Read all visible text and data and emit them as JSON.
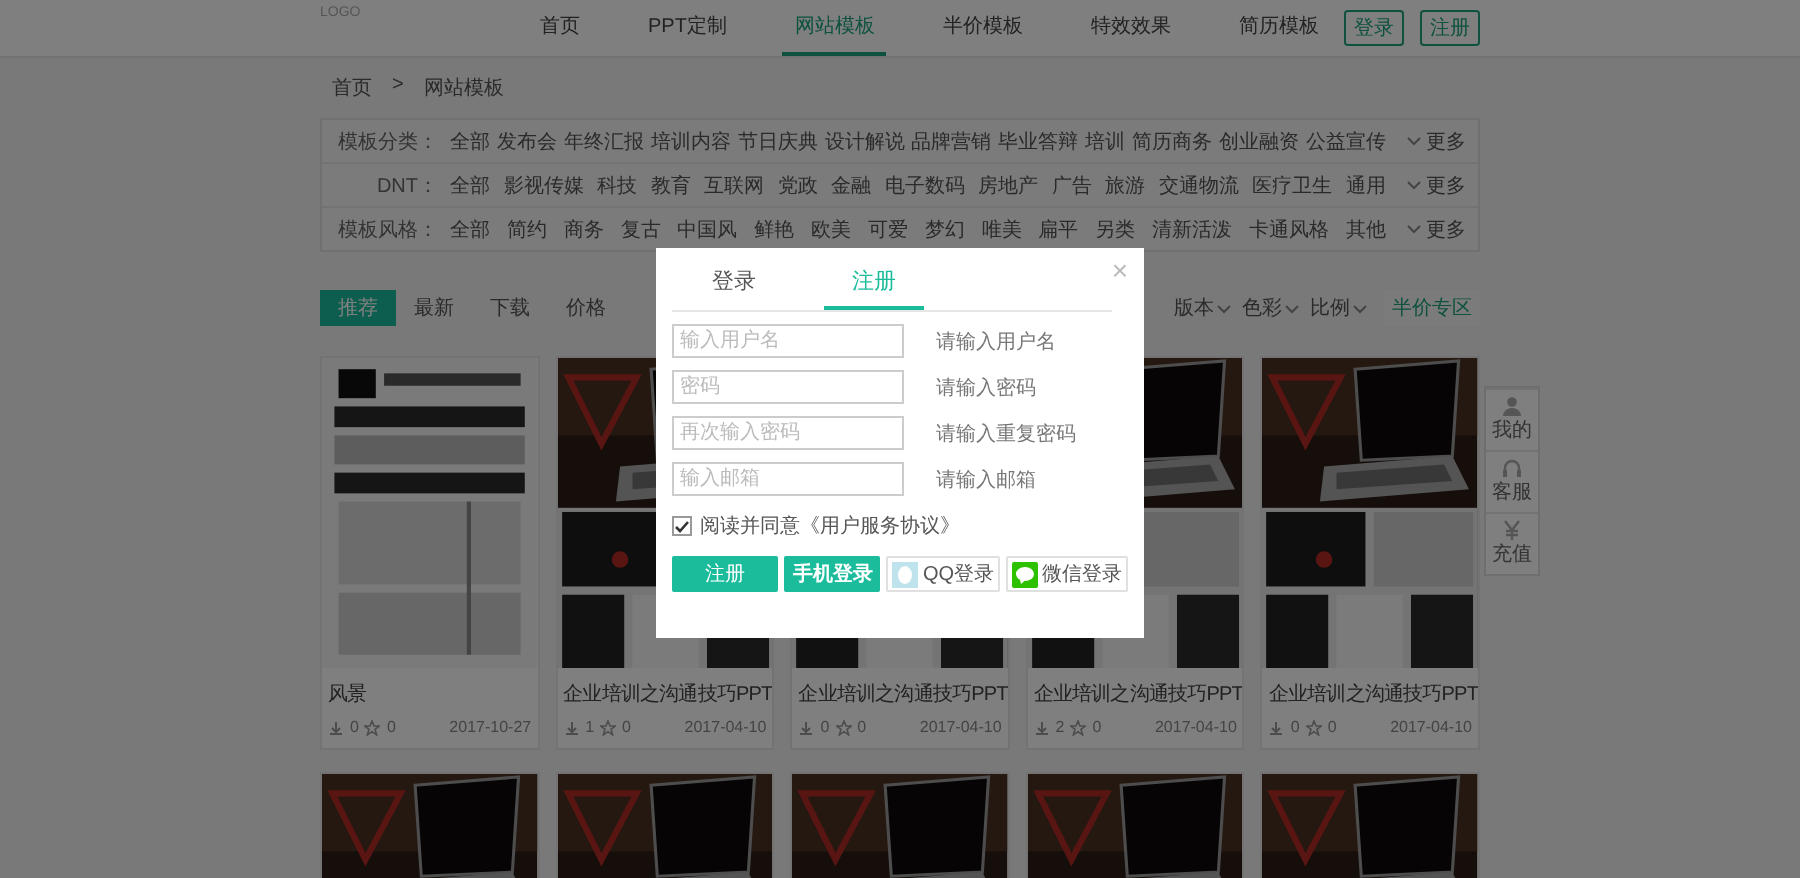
{
  "header": {
    "logo": "LOGO",
    "nav": [
      {
        "label": "首页",
        "selected": false
      },
      {
        "label": "PPT定制",
        "selected": false
      },
      {
        "label": "网站模板",
        "selected": true
      },
      {
        "label": "半价模板",
        "selected": false
      },
      {
        "label": "特效效果",
        "selected": false
      },
      {
        "label": "简历模板",
        "selected": false
      }
    ],
    "buttons": [
      "登录",
      "注册"
    ]
  },
  "breadcrumb": {
    "items": [
      "首页",
      "网站模板"
    ],
    "separator": ">"
  },
  "filters": [
    {
      "label": "模板分类：",
      "options": [
        "全部",
        "发布会",
        "年终汇报",
        "培训内容",
        "节日庆典",
        "设计解说",
        "品牌营销",
        "毕业答辩",
        "培训",
        "简历商务",
        "创业融资",
        "公益宣传"
      ],
      "more": "更多"
    },
    {
      "label": "DNT：",
      "options": [
        "全部",
        "影视传媒",
        "科技",
        "教育",
        "互联网",
        "党政",
        "金融",
        "电子数码",
        "房地产",
        "广告",
        "旅游",
        "交通物流",
        "医疗卫生",
        "通用"
      ],
      "more": "更多"
    },
    {
      "label": "模板风格：",
      "options": [
        "全部",
        "简约",
        "商务",
        "复古",
        "中国风",
        "鲜艳",
        "欧美",
        "可爱",
        "梦幻",
        "唯美",
        "扁平",
        "另类",
        "清新活泼",
        "卡通风格",
        "其他"
      ],
      "more": "更多"
    }
  ],
  "sort": {
    "tabs": [
      {
        "label": "推荐",
        "selected": true
      },
      {
        "label": "最新",
        "selected": false
      },
      {
        "label": "下载",
        "selected": false
      },
      {
        "label": "价格",
        "selected": false
      }
    ],
    "dropdowns": [
      "版本",
      "色彩",
      "比例"
    ],
    "link": "半价专区"
  },
  "cards": [
    {
      "kind": "scan",
      "title": "风景",
      "downloads": "0",
      "favorites": "0",
      "date": "2017-10-27"
    },
    {
      "kind": "slides",
      "title": "企业培训之沟通技巧PPT",
      "downloads": "1",
      "favorites": "0",
      "date": "2017-04-10"
    },
    {
      "kind": "slides",
      "title": "企业培训之沟通技巧PPT",
      "downloads": "0",
      "favorites": "0",
      "date": "2017-04-10"
    },
    {
      "kind": "slides",
      "title": "企业培训之沟通技巧PPT",
      "downloads": "2",
      "favorites": "0",
      "date": "2017-04-10"
    },
    {
      "kind": "slides",
      "title": "企业培训之沟通技巧PPT",
      "downloads": "0",
      "favorites": "0",
      "date": "2017-04-10"
    },
    {
      "kind": "slides"
    },
    {
      "kind": "slides"
    },
    {
      "kind": "slides"
    },
    {
      "kind": "slides"
    },
    {
      "kind": "slides"
    }
  ],
  "side_toolbar": [
    {
      "kind": "user",
      "label": "我的"
    },
    {
      "kind": "support",
      "label": "客服"
    },
    {
      "kind": "recharge",
      "label": "充值"
    }
  ],
  "modal": {
    "close": "×",
    "tabs": [
      {
        "label": "登录",
        "selected": false
      },
      {
        "label": "注册",
        "selected": true
      }
    ],
    "fields": [
      {
        "placeholder": "输入用户名",
        "hint": "请输入用户名"
      },
      {
        "placeholder": "密码",
        "hint": "请输入密码"
      },
      {
        "placeholder": "再次输入密码",
        "hint": "请输入重复密码"
      },
      {
        "placeholder": "输入邮箱",
        "hint": "请输入邮箱"
      }
    ],
    "agreement": {
      "checked": true,
      "text": "阅读并同意《用户服务协议》"
    },
    "buttons": [
      {
        "kind": "primary",
        "label": "注册"
      },
      {
        "kind": "secondary",
        "label": "手机登录"
      },
      {
        "kind": "qq",
        "label": "QQ登录"
      },
      {
        "kind": "wechat",
        "label": "微信登录"
      }
    ]
  }
}
